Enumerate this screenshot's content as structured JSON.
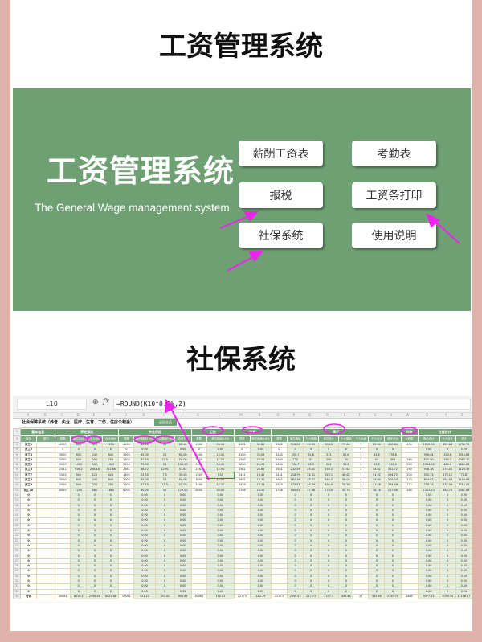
{
  "page_title": "工资管理系统",
  "panel": {
    "title": "工资管理系统",
    "subtitle": "The General Wage management system",
    "buttons": [
      "薪酬工资表",
      "考勤表",
      "报税",
      "工资条打印",
      "社保系统",
      "使用说明"
    ]
  },
  "section_title": "社保系统",
  "sheet": {
    "name_box": "L10",
    "formula": "=ROUND(K10*0.5%,2)",
    "col_letters": [
      "A",
      "B",
      "C",
      "D",
      "E",
      "F",
      "G",
      "H",
      "I",
      "J",
      "K",
      "L",
      "M",
      "N",
      "O",
      "P",
      "Q",
      "R",
      "S",
      "T",
      "U",
      "V",
      "W",
      "X",
      "Y",
      "Z"
    ],
    "title": "社会保障系统（养老、失业、医疗、生育、工伤、住房公积金）",
    "back_button": "返回主页",
    "groups": [
      [
        "基本信息",
        2
      ],
      [
        "养老保险",
        4
      ],
      [
        "失业保险",
        4
      ],
      [
        "工伤",
        2
      ],
      [
        "生育",
        2
      ],
      [
        "医疗",
        8
      ],
      [
        "住房",
        1
      ],
      [
        "社保合计",
        3
      ]
    ],
    "headers": [
      "姓名",
      "部门",
      "基数",
      "单位20%",
      "个人8%",
      "合计28%",
      "基数",
      "单位缴纳1.5%",
      "个人缴纳0.5%",
      "合计2%",
      "基数",
      "单位缴纳0.5%",
      "基数",
      "单位缴纳0.8%",
      "基数",
      "单位缴纳",
      "个人缴纳",
      "单位合计",
      "个人缴纳",
      "个人大病",
      "个人合计",
      "医疗合计",
      "公积金",
      "单位合计",
      "个人合计",
      "总计"
    ],
    "rows": [
      [
        "员工1",
        "",
        "4000",
        "800",
        "320",
        "1120",
        "4000",
        "60.00",
        "20",
        "80.00",
        "4000",
        "20.00",
        "3982",
        "31.86",
        "3982",
        "318.56",
        "39.82",
        "398.2",
        "79.64",
        "3",
        "82.64",
        "480.84",
        "400",
        "1310.06",
        "422.64",
        "1732.70"
      ],
      [
        "员工2",
        "",
        "0",
        "0",
        "0",
        "0",
        "0",
        "0.00",
        "0",
        "0.00",
        "0",
        "0.00",
        "0",
        "0.00",
        "0",
        "0",
        "0",
        "0",
        "0",
        "0",
        "0",
        "0",
        "",
        "0.00",
        "0",
        "0.00"
      ],
      [
        "员工3",
        "",
        "3000",
        "600",
        "240",
        "840",
        "3000",
        "45.00",
        "15",
        "60.00",
        "3000",
        "15.00",
        "3180",
        "25.04",
        "3180",
        "255.7",
        "31.8",
        "313",
        "62.6",
        "3",
        "63.6",
        "378.6",
        "",
        "998.04",
        "320.6",
        "1318.64"
      ],
      [
        "员工4",
        "",
        "2500",
        "500",
        "200",
        "700",
        "2500",
        "37.50",
        "12.5",
        "50.00",
        "2500",
        "12.50",
        "2500",
        "20.00",
        "2500",
        "223",
        "25",
        "250",
        "50",
        "3",
        "53",
        "303",
        "260",
        "820.00",
        "263.3",
        "1083.30"
      ],
      [
        "员工5",
        "",
        "5000",
        "1000",
        "400",
        "1400",
        "5000",
        "75.00",
        "25",
        "100.00",
        "5000",
        "25.00",
        "2630",
        "21.04",
        "2630",
        "236.7",
        "26.3",
        "263",
        "52.6",
        "3",
        "53.6",
        "318.6",
        "250",
        "1384.04",
        "480.6",
        "1864.64"
      ],
      [
        "员工6",
        "",
        "2581",
        "516.2",
        "206.48",
        "722.68",
        "2581",
        "38.72",
        "12.91",
        "51.62",
        "2581",
        "12.91",
        "2581",
        "20.65",
        "2581",
        "232.29",
        "25.81",
        "258.1",
        "51.62",
        "3",
        "54.62",
        "312.72",
        "250",
        "946.38",
        "276.01",
        "1120.39"
      ],
      [
        "员工7",
        "",
        "1500",
        "300",
        "120",
        "420",
        "1500",
        "22.50",
        "7.5",
        "30.00",
        "1500",
        "7.50",
        "2431",
        "19.45",
        "2431",
        "218.79",
        "24.31",
        "243.1",
        "48.62",
        "3",
        "51.62",
        "294.72",
        "200",
        "592.33",
        "179.12",
        "771.67"
      ],
      [
        "员工8",
        "",
        "3000",
        "600",
        "240",
        "840",
        "3000",
        "45.00",
        "15",
        "60.00",
        "3000",
        "15.00",
        "1802",
        "14.42",
        "1802",
        "162.18",
        "18.02",
        "180.2",
        "36.04",
        "3",
        "39.04",
        "219.24",
        "170",
        "854.62",
        "294.04",
        "1148.66"
      ],
      [
        "员工9",
        "",
        "2500",
        "500",
        "200",
        "700",
        "2500",
        "37.50",
        "12.5",
        "50.00",
        "2500",
        "12.50",
        "1929",
        "15.43",
        "1929",
        "173.61",
        "19.29",
        "192.9",
        "38.58",
        "3",
        "41.58",
        "234.48",
        "122",
        "758.33",
        "234.08",
        "1012.41"
      ],
      [
        "员工10",
        "",
        "6000",
        "1200",
        "480",
        "1680",
        "6000",
        "90.00",
        "30",
        "120.00",
        "6000",
        "30.00",
        "1788",
        "14.30",
        "1788",
        "160.92",
        "17.88",
        "178.8",
        "35.76",
        "3",
        "38.76",
        "217.56",
        "180",
        "1313.10",
        "348.76",
        "2061.86"
      ]
    ],
    "empty_row": [
      "0",
      "",
      "",
      "0",
      "0",
      "0",
      "",
      "0.00",
      "0",
      "0.00",
      "",
      "0.00",
      "",
      "0.00",
      "",
      "0",
      "0",
      "0",
      "0",
      "",
      "0",
      "0",
      "",
      "0.00",
      "0",
      "0.00"
    ],
    "empty_row_count": 20,
    "total_row": [
      "合计",
      "",
      "30081",
      "6016.2",
      "2406.48",
      "8422.68",
      "30081",
      "451.22",
      "150.41",
      "601.63",
      "30081",
      "150.41",
      "22773",
      "182.19",
      "22773",
      "2049.57",
      "227.73",
      "2277.3",
      "455.46",
      "27",
      "482.46",
      "2759.76",
      "1882",
      "9077.32",
      "3039.35",
      "12116.67"
    ],
    "selected_row": 7,
    "selected_col": 11
  },
  "colors": {
    "panel_green": "#6fa074",
    "annotation": "#ee22ee",
    "frame": "#dfb3aa"
  }
}
